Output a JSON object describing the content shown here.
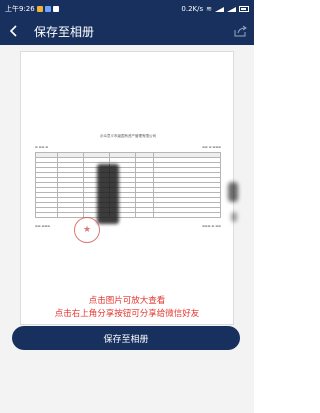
{
  "status_bar": {
    "time": "上午9:26",
    "network_speed": "0.2K/s"
  },
  "nav": {
    "title": "保存至相册",
    "back_icon": "chevron-left-icon",
    "share_icon": "share-icon"
  },
  "document": {
    "title": "示众意义市级国有资产管理有限公司"
  },
  "hints": {
    "line1": "点击图片可放大查看",
    "line2": "点击右上角分享按钮可分享给微信好友"
  },
  "actions": {
    "save_label": "保存至相册"
  },
  "colors": {
    "primary": "#17305e",
    "hint": "#e3342f",
    "stamp": "#d34a4a"
  }
}
